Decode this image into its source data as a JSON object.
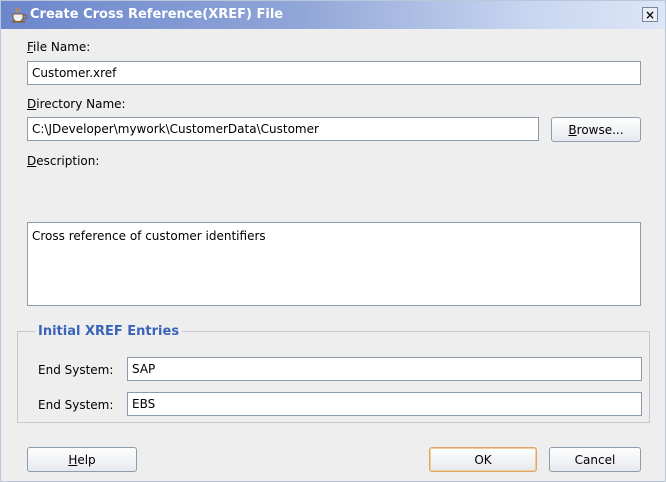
{
  "window": {
    "title": "Create Cross Reference(XREF) File",
    "close_glyph": "×"
  },
  "form": {
    "file_name": {
      "label_mnemonic": "F",
      "label_rest": "ile Name:",
      "value": "Customer.xref"
    },
    "directory_name": {
      "label_mnemonic": "D",
      "label_rest": "irectory Name:",
      "value": "C:\\JDeveloper\\mywork\\CustomerData\\Customer"
    },
    "browse_button": {
      "mnemonic": "B",
      "rest": "rowse..."
    },
    "description": {
      "label_mnemonic": "D",
      "label_rest": "escription:",
      "value": "Cross reference of customer identifiers"
    }
  },
  "xref_entries": {
    "title": "Initial XREF Entries",
    "rows": [
      {
        "label": "End System:",
        "value": "SAP"
      },
      {
        "label": "End System:",
        "value": "EBS"
      }
    ]
  },
  "buttons": {
    "help": {
      "mnemonic": "H",
      "rest": "elp"
    },
    "ok": "OK",
    "cancel": "Cancel"
  },
  "colors": {
    "group_title": "#3b63b8",
    "title_text": "#ffffff"
  }
}
